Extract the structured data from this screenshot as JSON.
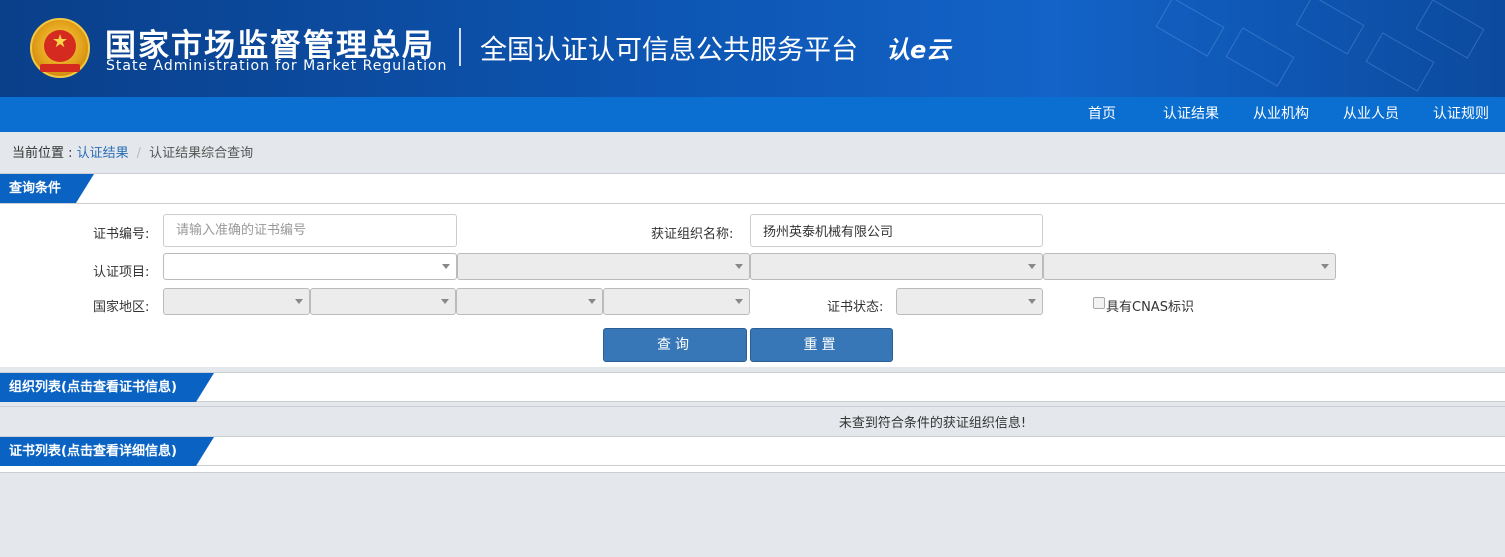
{
  "header": {
    "agency_cn": "国家市场监督管理总局",
    "agency_en": "State Administration  for  Market Regulation",
    "platform": "全国认证认可信息公共服务平台",
    "logo_text": "认e云"
  },
  "nav": {
    "items": [
      {
        "label": "首页"
      },
      {
        "label": "认证结果"
      },
      {
        "label": "从业机构"
      },
      {
        "label": "从业人员"
      },
      {
        "label": "认证规则"
      }
    ]
  },
  "breadcrumb": {
    "prefix": "当前位置 : ",
    "link": "认证结果",
    "separator": "/",
    "current": "认证结果综合查询"
  },
  "query": {
    "section_title": "查询条件",
    "cert_no_label": "证书编号:",
    "cert_no_placeholder": "请输入准确的证书编号",
    "cert_no_value": "",
    "org_name_label": "获证组织名称:",
    "org_name_value": "扬州英泰机械有限公司",
    "project_label": "认证项目:",
    "region_label": "国家地区:",
    "status_label": "证书状态:",
    "cnas_label": "具有CNAS标识",
    "cnas_checked": false,
    "search_button": "查询",
    "reset_button": "重置"
  },
  "org_list": {
    "section_title": "组织列表(点击查看证书信息)",
    "empty_message": "未查到符合条件的获证组织信息!"
  },
  "cert_list": {
    "section_title": "证书列表(点击查看详细信息)"
  },
  "colors": {
    "banner": "#0d56b3",
    "nav": "#0a6fd1",
    "section_tab": "#0a63c2",
    "button": "#3777b8",
    "link": "#2a6db5"
  }
}
